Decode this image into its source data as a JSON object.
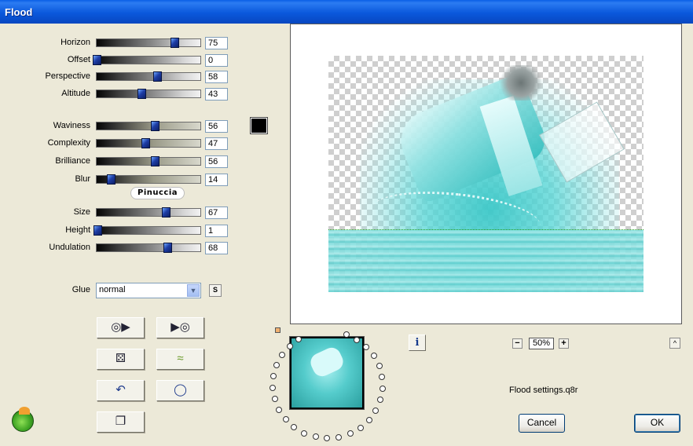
{
  "window": {
    "title": "Flood"
  },
  "params_group1": [
    {
      "id": "horizon",
      "label": "Horizon",
      "value": "75",
      "fraction": 0.75
    },
    {
      "id": "offset",
      "label": "Offset",
      "value": "0",
      "fraction": 0.0
    },
    {
      "id": "perspective",
      "label": "Perspective",
      "value": "58",
      "fraction": 0.58
    },
    {
      "id": "altitude",
      "label": "Altitude",
      "value": "43",
      "fraction": 0.43
    }
  ],
  "params_group2": [
    {
      "id": "waviness",
      "label": "Waviness",
      "value": "56",
      "fraction": 0.56
    },
    {
      "id": "complexity",
      "label": "Complexity",
      "value": "47",
      "fraction": 0.47
    },
    {
      "id": "brilliance",
      "label": "Brilliance",
      "value": "56",
      "fraction": 0.56
    },
    {
      "id": "blur",
      "label": "Blur",
      "value": "14",
      "fraction": 0.14
    }
  ],
  "params_group3": [
    {
      "id": "size",
      "label": "Size",
      "value": "67",
      "fraction": 0.67
    },
    {
      "id": "height",
      "label": "Height",
      "value": "1",
      "fraction": 0.01
    },
    {
      "id": "undulation",
      "label": "Undulation",
      "value": "68",
      "fraction": 0.68
    }
  ],
  "color_swatch": {
    "color": "#000000"
  },
  "watermark_text": "Pinuccia",
  "glue": {
    "label": "Glue",
    "selected": "normal",
    "extra_button": "S"
  },
  "tool_buttons": [
    {
      "id": "load-preset",
      "icon": "disc-arrow-icon",
      "glyph": "◎▶"
    },
    {
      "id": "save-preset",
      "icon": "arrow-disc-icon",
      "glyph": "▶◎"
    },
    {
      "id": "randomize",
      "icon": "dice-icon",
      "glyph": "⚄"
    },
    {
      "id": "wave",
      "icon": "wave-icon",
      "glyph": "≈"
    },
    {
      "id": "undo",
      "icon": "undo-arrow-icon",
      "glyph": "↶"
    },
    {
      "id": "reset",
      "icon": "circle-reset-icon",
      "glyph": "◯"
    },
    {
      "id": "copy",
      "icon": "document-copy-icon",
      "glyph": "❐"
    }
  ],
  "zoom": {
    "value": "50%",
    "minus": "−",
    "plus": "+"
  },
  "info_glyph": "i",
  "collapse_glyph": "^",
  "settings_file": "Flood settings.q8r",
  "buttons": {
    "cancel": "Cancel",
    "ok": "OK"
  },
  "colors": {
    "accent": "#0a58dc",
    "water": "#4cc8c8"
  }
}
